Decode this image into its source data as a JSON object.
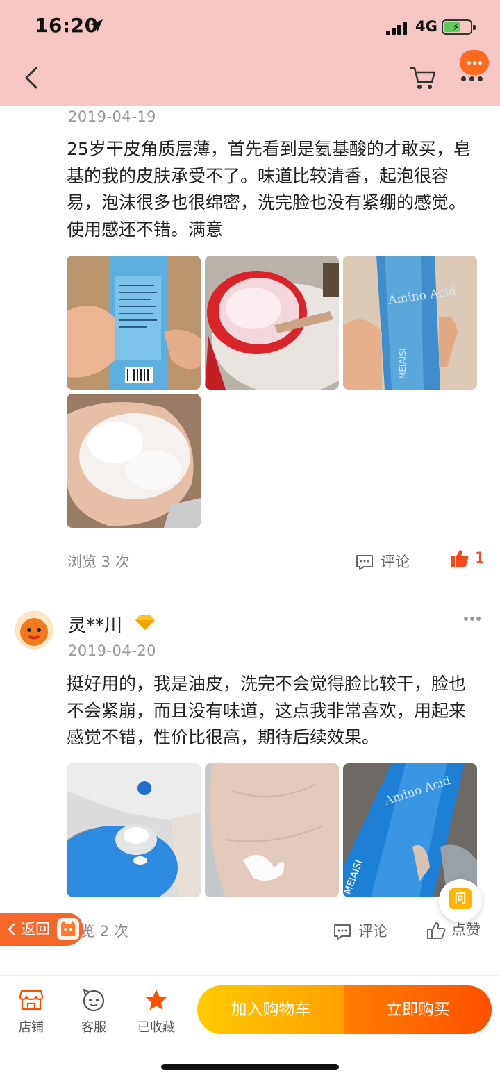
{
  "status_bar": {
    "time": "16:20",
    "network": "4G"
  },
  "reviews": [
    {
      "date": "2019-04-19",
      "text": "25岁干皮角质层薄，首先看到是氨基酸的才敢买，皂基的我的皮肤承受不了。味道比较清香，起泡很容易，泡沫很多也很绵密，洗完脸也没有紧绷的感觉。使用感还不错。满意",
      "views": "浏览 3 次",
      "comment_label": "评论",
      "likes": "1",
      "liked": true
    },
    {
      "username": "灵**川",
      "date": "2019-04-20",
      "text": "挺好用的，我是油皮，洗完不会觉得脸比较干，脸也不会紧崩，而且没有味道，这点我非常喜欢，用起来感觉不错，性价比很高，期待后续效果。",
      "views": "览 2 次",
      "comment_label": "评论",
      "like_label": "点赞",
      "liked": false
    }
  ],
  "floating": {
    "back_label": "返回",
    "ask_label": "问"
  },
  "bottom_bar": {
    "store_label": "店铺",
    "service_label": "客服",
    "favorite_label": "已收藏",
    "add_to_cart_label": "加入购物车",
    "buy_now_label": "立即购买"
  },
  "colors": {
    "accent": "#ff5000",
    "like_active": "#f5481f",
    "nav_bg": "#f6c6c4"
  }
}
